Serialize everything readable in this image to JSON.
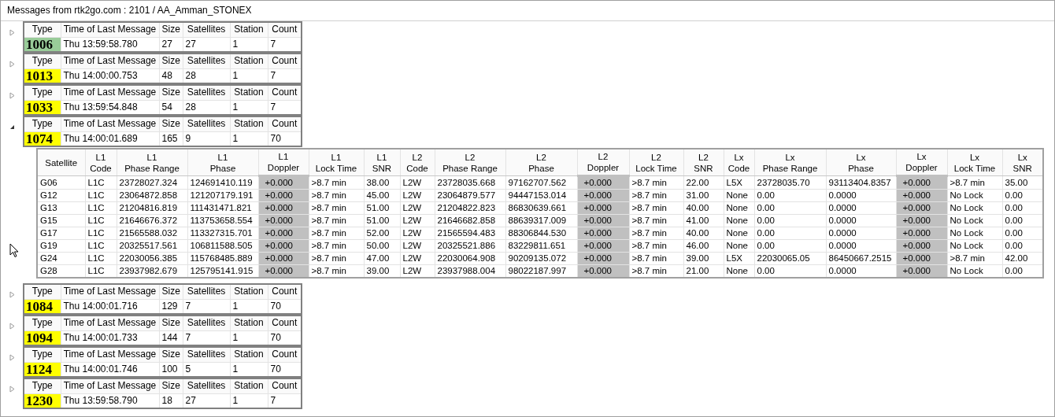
{
  "window": {
    "title": "Messages from rtk2go.com : 2101 / AA_Amman_STONEX"
  },
  "messages": [
    {
      "columns": [
        "Type",
        "Time of Last Message",
        "Size",
        "Satellites",
        "Station",
        "Count"
      ],
      "type": "1006",
      "color": "#99cc99",
      "time": "Thu 13:59:58.780",
      "size": "27",
      "satellites": "27",
      "station": "1",
      "count": "7",
      "expanded": false
    },
    {
      "columns": [
        "Type",
        "Time of Last Message",
        "Size",
        "Satellites",
        "Station",
        "Count"
      ],
      "type": "1013",
      "color": "#ffff00",
      "time": "Thu 14:00:00.753",
      "size": "48",
      "satellites": "28",
      "station": "1",
      "count": "7",
      "expanded": false
    },
    {
      "columns": [
        "Type",
        "Time of Last Message",
        "Size",
        "Satellites",
        "Station",
        "Count"
      ],
      "type": "1033",
      "color": "#ffff00",
      "time": "Thu 13:59:54.848",
      "size": "54",
      "satellites": "28",
      "station": "1",
      "count": "7",
      "expanded": false
    },
    {
      "columns": [
        "Type",
        "Time of Last Message",
        "Size",
        "Satellites",
        "Station",
        "Count"
      ],
      "type": "1074",
      "color": "#ffff00",
      "time": "Thu 14:00:01.689",
      "size": "165",
      "satellites": "9",
      "station": "1",
      "count": "70",
      "expanded": true,
      "detail": {
        "columns": [
          {
            "bottom": "Satellite",
            "shaded": false
          },
          {
            "top": "L1",
            "bottom": "Code",
            "shaded": false
          },
          {
            "top": "L1",
            "bottom": "Phase Range",
            "shaded": false
          },
          {
            "top": "L1",
            "bottom": "Phase",
            "shaded": false
          },
          {
            "top": "L1",
            "bottom": "Doppler",
            "shaded": true
          },
          {
            "top": "L1",
            "bottom": "Lock Time",
            "shaded": false
          },
          {
            "top": "L1",
            "bottom": "SNR",
            "shaded": false
          },
          {
            "top": "L2",
            "bottom": "Code",
            "shaded": false
          },
          {
            "top": "L2",
            "bottom": "Phase Range",
            "shaded": false
          },
          {
            "top": "L2",
            "bottom": "Phase",
            "shaded": false
          },
          {
            "top": "L2",
            "bottom": "Doppler",
            "shaded": true
          },
          {
            "top": "L2",
            "bottom": "Lock Time",
            "shaded": false
          },
          {
            "top": "L2",
            "bottom": "SNR",
            "shaded": false
          },
          {
            "top": "Lx",
            "bottom": "Code",
            "shaded": false
          },
          {
            "top": "Lx",
            "bottom": "Phase Range",
            "shaded": false
          },
          {
            "top": "Lx",
            "bottom": "Phase",
            "shaded": false
          },
          {
            "top": "Lx",
            "bottom": "Doppler",
            "shaded": true
          },
          {
            "top": "Lx",
            "bottom": "Lock Time",
            "shaded": false
          },
          {
            "top": "Lx",
            "bottom": "SNR",
            "shaded": false
          }
        ],
        "rows": [
          [
            "G06",
            "L1C",
            "23728027.324",
            "124691410.119",
            "+0.000",
            ">8.7 min",
            "38.00",
            "L2W",
            "23728035.668",
            "97162707.562",
            "+0.000",
            ">8.7 min",
            "22.00",
            "L5X",
            "23728035.70",
            "93113404.8357",
            "+0.000",
            ">8.7 min",
            "35.00"
          ],
          [
            "G12",
            "L1C",
            "23064872.858",
            "121207179.191",
            "+0.000",
            ">8.7 min",
            "45.00",
            "L2W",
            "23064879.577",
            "94447153.014",
            "+0.000",
            ">8.7 min",
            "31.00",
            "None",
            "0.00",
            "0.0000",
            "+0.000",
            "No Lock",
            "0.00"
          ],
          [
            "G13",
            "L1C",
            "21204816.819",
            "111431471.821",
            "+0.000",
            ">8.7 min",
            "51.00",
            "L2W",
            "21204822.823",
            "86830639.661",
            "+0.000",
            ">8.7 min",
            "40.00",
            "None",
            "0.00",
            "0.0000",
            "+0.000",
            "No Lock",
            "0.00"
          ],
          [
            "G15",
            "L1C",
            "21646676.372",
            "113753658.554",
            "+0.000",
            ">8.7 min",
            "51.00",
            "L2W",
            "21646682.858",
            "88639317.009",
            "+0.000",
            ">8.7 min",
            "41.00",
            "None",
            "0.00",
            "0.0000",
            "+0.000",
            "No Lock",
            "0.00"
          ],
          [
            "G17",
            "L1C",
            "21565588.032",
            "113327315.701",
            "+0.000",
            ">8.7 min",
            "52.00",
            "L2W",
            "21565594.483",
            "88306844.530",
            "+0.000",
            ">8.7 min",
            "40.00",
            "None",
            "0.00",
            "0.0000",
            "+0.000",
            "No Lock",
            "0.00"
          ],
          [
            "G19",
            "L1C",
            "20325517.561",
            "106811588.505",
            "+0.000",
            ">8.7 min",
            "50.00",
            "L2W",
            "20325521.886",
            "83229811.651",
            "+0.000",
            ">8.7 min",
            "46.00",
            "None",
            "0.00",
            "0.0000",
            "+0.000",
            "No Lock",
            "0.00"
          ],
          [
            "G24",
            "L1C",
            "22030056.385",
            "115768485.889",
            "+0.000",
            ">8.7 min",
            "47.00",
            "L2W",
            "22030064.908",
            "90209135.072",
            "+0.000",
            ">8.7 min",
            "39.00",
            "L5X",
            "22030065.05",
            "86450667.2515",
            "+0.000",
            ">8.7 min",
            "42.00"
          ],
          [
            "G28",
            "L1C",
            "23937982.679",
            "125795141.915",
            "+0.000",
            ">8.7 min",
            "39.00",
            "L2W",
            "23937988.004",
            "98022187.997",
            "+0.000",
            ">8.7 min",
            "21.00",
            "None",
            "0.00",
            "0.0000",
            "+0.000",
            "No Lock",
            "0.00"
          ]
        ]
      }
    },
    {
      "columns": [
        "Type",
        "Time of Last Message",
        "Size",
        "Satellites",
        "Station",
        "Count"
      ],
      "type": "1084",
      "color": "#ffff00",
      "time": "Thu 14:00:01.716",
      "size": "129",
      "satellites": "7",
      "station": "1",
      "count": "70",
      "expanded": false
    },
    {
      "columns": [
        "Type",
        "Time of Last Message",
        "Size",
        "Satellites",
        "Station",
        "Count"
      ],
      "type": "1094",
      "color": "#ffff00",
      "time": "Thu 14:00:01.733",
      "size": "144",
      "satellites": "7",
      "station": "1",
      "count": "70",
      "expanded": false
    },
    {
      "columns": [
        "Type",
        "Time of Last Message",
        "Size",
        "Satellites",
        "Station",
        "Count"
      ],
      "type": "1124",
      "color": "#ffff00",
      "time": "Thu 14:00:01.746",
      "size": "100",
      "satellites": "5",
      "station": "1",
      "count": "70",
      "expanded": false
    },
    {
      "columns": [
        "Type",
        "Time of Last Message",
        "Size",
        "Satellites",
        "Station",
        "Count"
      ],
      "type": "1230",
      "color": "#ffff00",
      "time": "Thu 13:59:58.790",
      "size": "18",
      "satellites": "27",
      "station": "1",
      "count": "7",
      "expanded": false
    }
  ]
}
